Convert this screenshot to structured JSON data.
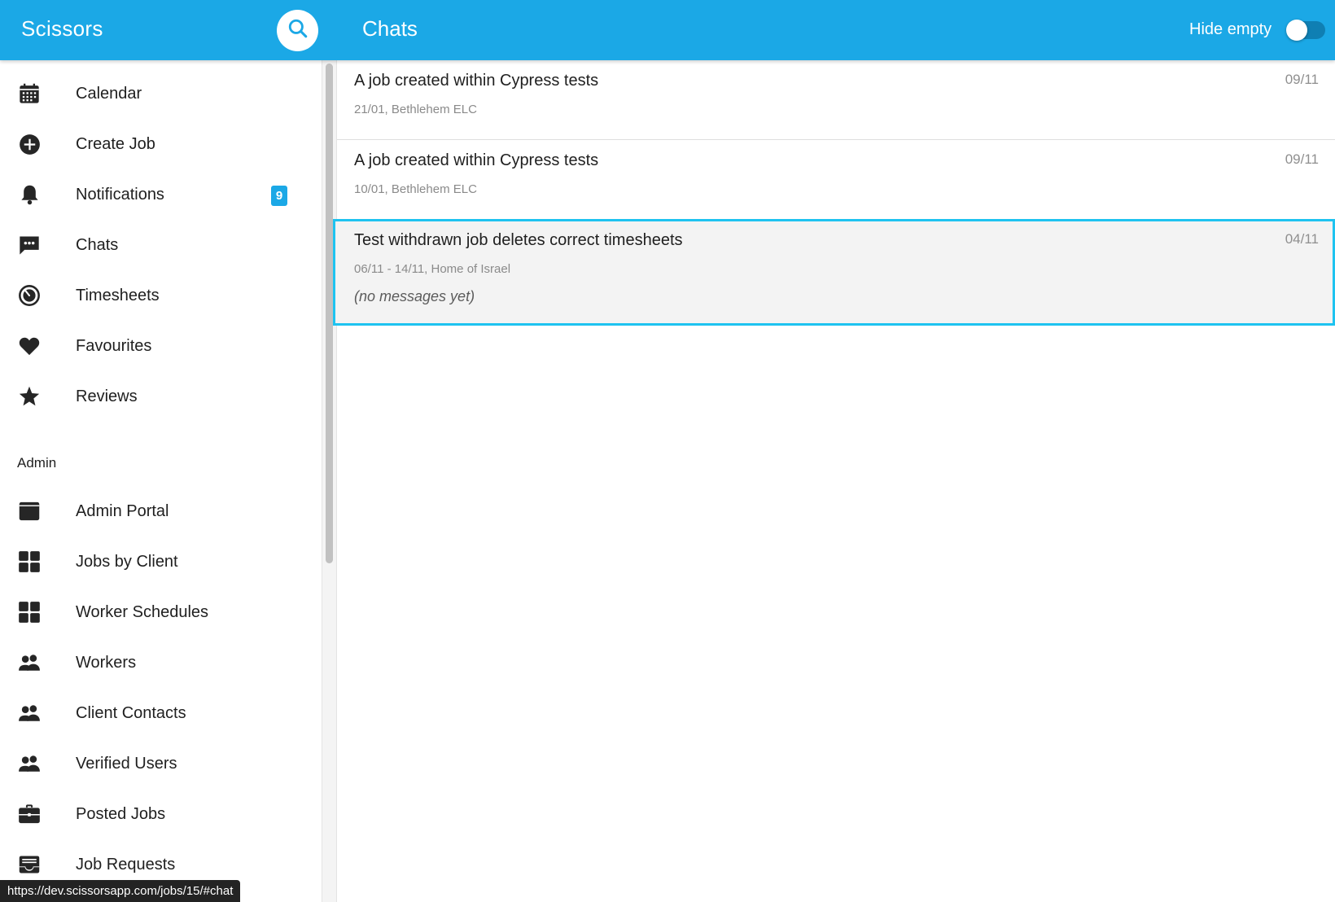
{
  "app": {
    "title": "Scissors"
  },
  "header": {
    "page_title": "Chats",
    "hide_empty_label": "Hide empty",
    "hide_empty_on": false,
    "search_icon": "search-icon"
  },
  "sidebar": {
    "items": [
      {
        "label": "Calendar",
        "icon": "calendar-icon"
      },
      {
        "label": "Create Job",
        "icon": "add-circle-icon"
      },
      {
        "label": "Notifications",
        "icon": "bell-icon",
        "badge": "9"
      },
      {
        "label": "Chats",
        "icon": "chat-bubble-icon"
      },
      {
        "label": "Timesheets",
        "icon": "timer-icon"
      },
      {
        "label": "Favourites",
        "icon": "heart-icon"
      },
      {
        "label": "Reviews",
        "icon": "star-icon"
      }
    ],
    "admin_label": "Admin",
    "admin_items": [
      {
        "label": "Admin Portal",
        "icon": "window-icon"
      },
      {
        "label": "Jobs by Client",
        "icon": "grid-icon"
      },
      {
        "label": "Worker Schedules",
        "icon": "grid-icon"
      },
      {
        "label": "Workers",
        "icon": "people-icon"
      },
      {
        "label": "Client Contacts",
        "icon": "people-icon"
      },
      {
        "label": "Verified Users",
        "icon": "people-icon"
      },
      {
        "label": "Posted Jobs",
        "icon": "briefcase-icon"
      },
      {
        "label": "Job Requests",
        "icon": "inbox-icon"
      }
    ]
  },
  "chats": [
    {
      "title": "A job created within Cypress tests",
      "subtitle": "21/01, Bethlehem ELC",
      "date": "09/11",
      "message": ""
    },
    {
      "title": "A job created within Cypress tests",
      "subtitle": "10/01, Bethlehem ELC",
      "date": "09/11",
      "message": ""
    },
    {
      "title": "Test withdrawn job deletes correct timesheets",
      "subtitle": "06/11 - 14/11, Home of Israel",
      "date": "04/11",
      "message": "(no messages yet)"
    }
  ],
  "status_bar": {
    "url": "https://dev.scissorsapp.com/jobs/15/#chat"
  },
  "colors": {
    "header": "#1ba8e6",
    "accent": "#1ec3f0",
    "badge": "#1ba8e6"
  }
}
